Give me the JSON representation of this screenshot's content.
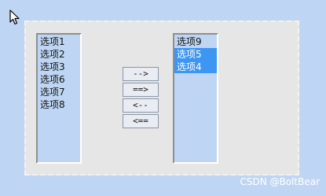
{
  "left_list": {
    "items": [
      {
        "label": "选项1",
        "selected": false
      },
      {
        "label": "选项2",
        "selected": false
      },
      {
        "label": "选项3",
        "selected": false
      },
      {
        "label": "选项6",
        "selected": false
      },
      {
        "label": "选项7",
        "selected": false
      },
      {
        "label": "选项8",
        "selected": false
      }
    ]
  },
  "right_list": {
    "items": [
      {
        "label": "选项9",
        "selected": false
      },
      {
        "label": "选项5",
        "selected": true
      },
      {
        "label": "选项4",
        "selected": true
      }
    ]
  },
  "buttons": {
    "move_selected_right": "-->",
    "move_all_right": "==>",
    "move_selected_left": "<--",
    "move_all_left": "<=="
  },
  "watermark": "CSDN @BoltBear",
  "colors": {
    "background": "#bed6f4",
    "panel": "#e6e6e6",
    "selection": "#3d96f2"
  }
}
